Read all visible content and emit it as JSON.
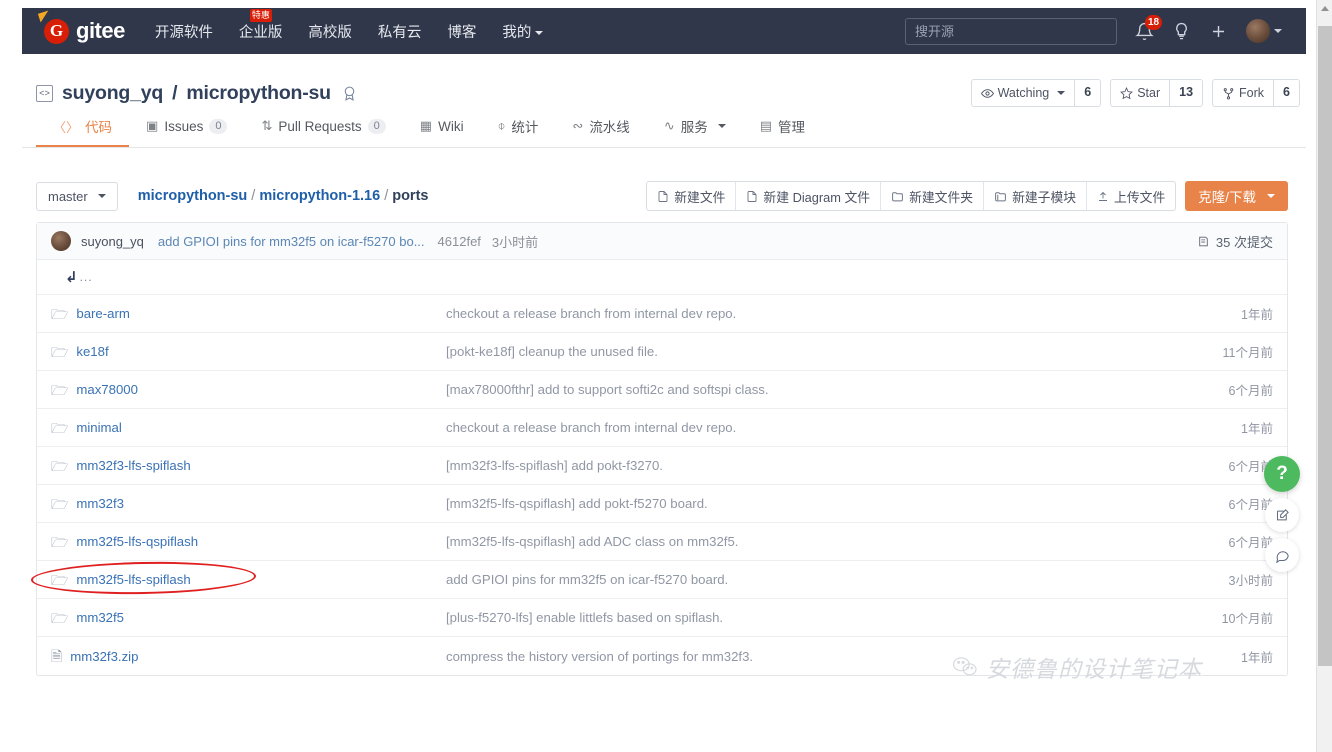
{
  "topnav": {
    "logo_text": "gitee",
    "logo_letter": "G",
    "menu": [
      {
        "label": "开源软件",
        "badge": ""
      },
      {
        "label": "企业版",
        "badge": "特惠"
      },
      {
        "label": "高校版",
        "badge": ""
      },
      {
        "label": "私有云",
        "badge": ""
      },
      {
        "label": "博客",
        "badge": ""
      },
      {
        "label": "我的",
        "badge": "",
        "caret": true
      }
    ],
    "search_placeholder": "搜开源",
    "notification_count": "18",
    "icons": {
      "bell": "bell-icon",
      "bulb": "lightbulb-icon",
      "plus": "plus-icon",
      "avatar": "user-avatar"
    }
  },
  "repo": {
    "owner": "suyong_yq",
    "separator": "/",
    "name": "micropython-su",
    "badge_icon": "award-badge-icon",
    "actions": [
      {
        "label": "Watching",
        "count": "6",
        "icon": "eye-icon",
        "caret": true
      },
      {
        "label": "Star",
        "count": "13",
        "icon": "star-icon",
        "caret": false
      },
      {
        "label": "Fork",
        "count": "6",
        "icon": "fork-icon",
        "caret": false
      }
    ]
  },
  "tabs": [
    {
      "label": "代码",
      "icon": "code-icon",
      "count": "",
      "active": true
    },
    {
      "label": "Issues",
      "icon": "issue-icon",
      "count": "0",
      "active": false
    },
    {
      "label": "Pull Requests",
      "icon": "pull-request-icon",
      "count": "0",
      "active": false
    },
    {
      "label": "Wiki",
      "icon": "wiki-icon",
      "count": "",
      "active": false
    },
    {
      "label": "统计",
      "icon": "chart-icon",
      "count": "",
      "active": false
    },
    {
      "label": "流水线",
      "icon": "pipeline-icon",
      "count": "",
      "active": false
    },
    {
      "label": "服务",
      "icon": "service-icon",
      "count": "",
      "active": false,
      "caret": true
    },
    {
      "label": "管理",
      "icon": "manage-icon",
      "count": "",
      "active": false
    }
  ],
  "toolbar": {
    "branch": "master",
    "breadcrumb": [
      "micropython-su",
      "micropython-1.16",
      "ports"
    ],
    "buttons": [
      {
        "label": "新建文件",
        "icon": "new-file-icon"
      },
      {
        "label": "新建 Diagram 文件",
        "icon": "new-diagram-icon"
      },
      {
        "label": "新建文件夹",
        "icon": "new-folder-icon"
      },
      {
        "label": "新建子模块",
        "icon": "new-submodule-icon"
      },
      {
        "label": "上传文件",
        "icon": "upload-icon"
      }
    ],
    "clone_label": "克隆/下载"
  },
  "commit_bar": {
    "author": "suyong_yq",
    "message": "add GPIOI pins for mm32f5 on icar-f5270 bo...",
    "sha": "4612fef",
    "time": "3小时前",
    "commit_count": "35 次提交",
    "commit_count_icon": "history-icon"
  },
  "parent_row": {
    "dots": "..."
  },
  "files": [
    {
      "name": "bare-arm",
      "type": "folder",
      "message": "checkout a release branch from internal dev repo.",
      "time": "1年前"
    },
    {
      "name": "ke18f",
      "type": "folder",
      "message": "[pokt-ke18f] cleanup the unused file.",
      "time": "11个月前"
    },
    {
      "name": "max78000",
      "type": "folder",
      "message": "[max78000fthr] add to support softi2c and softspi class.",
      "time": "6个月前"
    },
    {
      "name": "minimal",
      "type": "folder",
      "message": "checkout a release branch from internal dev repo.",
      "time": "1年前"
    },
    {
      "name": "mm32f3-lfs-spiflash",
      "type": "folder",
      "message": "[mm32f3-lfs-spiflash] add pokt-f3270.",
      "time": "6个月前"
    },
    {
      "name": "mm32f3",
      "type": "folder",
      "message": "[mm32f5-lfs-qspiflash] add pokt-f5270 board.",
      "time": "6个月前"
    },
    {
      "name": "mm32f5-lfs-qspiflash",
      "type": "folder",
      "message": "[mm32f5-lfs-qspiflash] add ADC class on mm32f5.",
      "time": "6个月前"
    },
    {
      "name": "mm32f5-lfs-spiflash",
      "type": "folder",
      "message": "add GPIOI pins for mm32f5 on icar-f5270 board.",
      "time": "3小时前",
      "highlighted": true
    },
    {
      "name": "mm32f5",
      "type": "folder",
      "message": "[plus-f5270-lfs] enable littlefs based on spiflash.",
      "time": "10个月前"
    },
    {
      "name": "mm32f3.zip",
      "type": "file",
      "message": "compress the history version of portings for mm32f3.",
      "time": "1年前"
    }
  ],
  "floating": [
    {
      "name": "help-button",
      "glyph": "?"
    },
    {
      "name": "feedback-button",
      "glyph": "✎"
    },
    {
      "name": "comment-button",
      "glyph": "⋯"
    }
  ],
  "watermark": {
    "text": "安德鲁的设计笔记本",
    "icon": "wechat-icon"
  },
  "colors": {
    "header_bg": "#30374a",
    "accent_orange": "#e8834a",
    "link_blue": "#3a72b5",
    "brand_red": "#d81e06",
    "help_green": "#4dba5f",
    "annotation_red": "#e02020"
  }
}
